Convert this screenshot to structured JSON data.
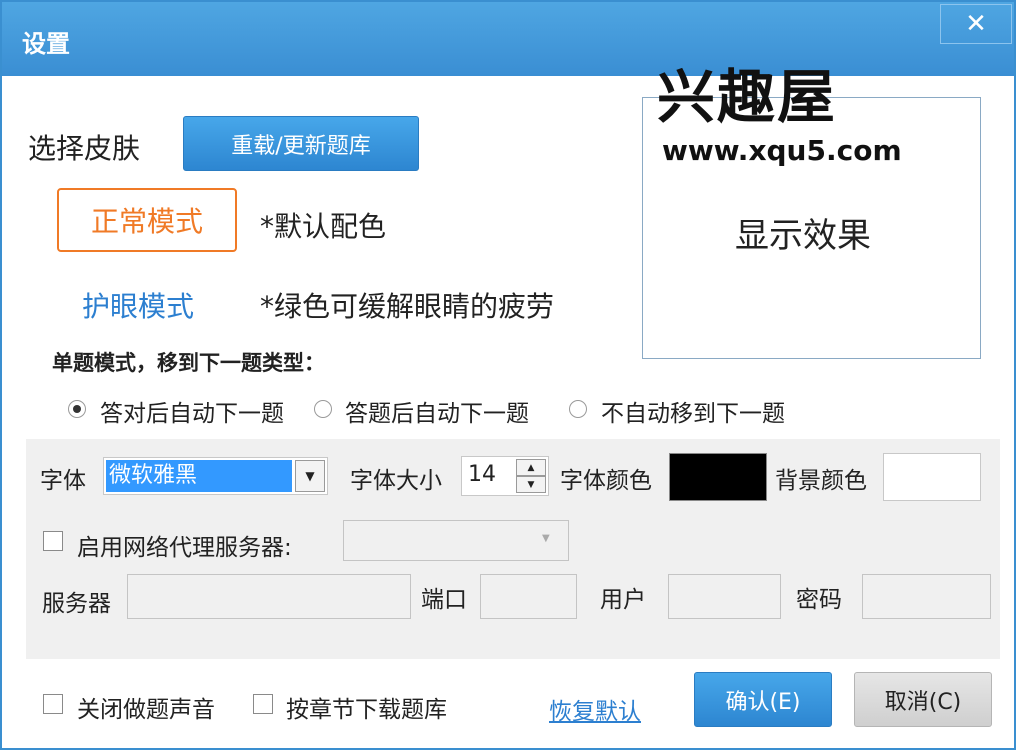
{
  "window": {
    "title": "设置",
    "close_glyph": "✕"
  },
  "logo": {
    "main": "兴趣屋",
    "url": "www.xqu5.com"
  },
  "skin": {
    "label": "选择皮肤",
    "reload_button": "重载/更新题库",
    "normal_mode": "正常模式",
    "normal_desc": "*默认配色",
    "eye_mode": "护眼模式",
    "eye_desc": "*绿色可缓解眼睛的疲劳",
    "preview_text": "显示效果"
  },
  "single_mode": {
    "heading": "单题模式，移到下一题类型：",
    "options": [
      "答对后自动下一题",
      "答题后自动下一题",
      "不自动移到下一题"
    ],
    "selected_index": 0
  },
  "font": {
    "font_label": "字体",
    "font_value": "微软雅黑",
    "size_label": "字体大小",
    "size_value": "14",
    "color_label": "字体颜色",
    "color_value": "#000000",
    "bg_label": "背景颜色",
    "bg_value": "#ffffff"
  },
  "proxy": {
    "enable_label": "启用网络代理服务器:",
    "server_label": "服务器",
    "port_label": "端口",
    "user_label": "用户",
    "password_label": "密码"
  },
  "footer": {
    "mute_label": "关闭做题声音",
    "chapter_download_label": "按章节下载题库",
    "restore_link": "恢复默认",
    "ok_button": "确认(E)",
    "cancel_button": "取消(C)"
  },
  "colors": {
    "title_bar": "#3a8ed3",
    "accent_orange": "#f07a26",
    "link_blue": "#2c7fd0"
  }
}
